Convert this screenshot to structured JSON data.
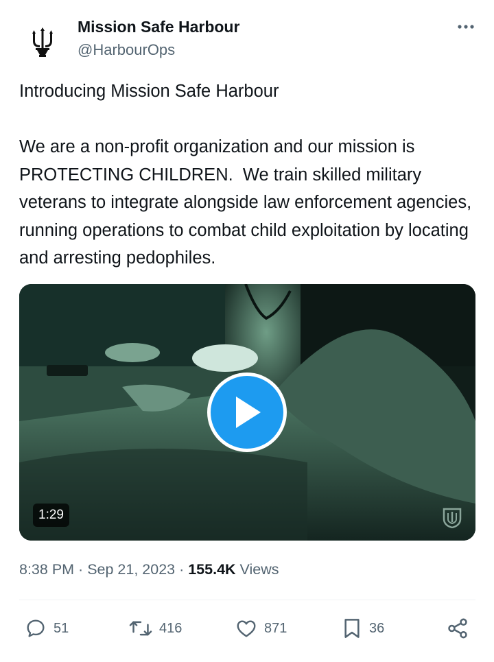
{
  "author": {
    "name": "Mission Safe Harbour",
    "handle": "@HarbourOps",
    "avatar_icon": "trident-logo-icon"
  },
  "post": {
    "text": "Introducing Mission Safe Harbour\n\nWe are a non-profit organization and our mission is PROTECTING CHILDREN.  We train skilled military veterans to integrate alongside law enforcement agencies, running operations to combat child exploitation by locating and arresting pedophiles."
  },
  "media": {
    "type": "video",
    "duration": "1:29",
    "play_icon": "play-icon",
    "watermark_icon": "shield-watermark-icon"
  },
  "meta": {
    "time": "8:38 PM",
    "separator": " · ",
    "date": "Sep 21, 2023",
    "views_count": "155.4K",
    "views_label": " Views"
  },
  "actions": {
    "replies": "51",
    "reposts": "416",
    "likes": "871",
    "bookmarks": "36"
  },
  "colors": {
    "accent": "#1d9bf0",
    "secondary_text": "#536471",
    "primary_text": "#0f1419"
  }
}
